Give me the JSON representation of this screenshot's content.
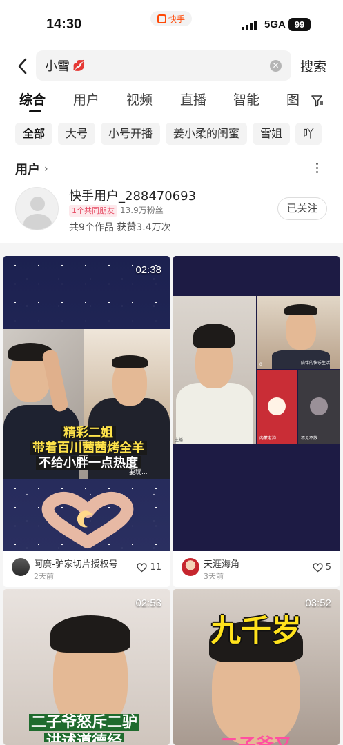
{
  "status": {
    "time": "14:30",
    "app_name": "快手",
    "network": "5GA",
    "battery": "99"
  },
  "search": {
    "query": "小雪",
    "emoji": "💋",
    "button": "搜索"
  },
  "tabs": [
    "综合",
    "用户",
    "视频",
    "直播",
    "智能",
    "图"
  ],
  "chips": [
    "全部",
    "大号",
    "小号开播",
    "姜小柔的闺蜜",
    "雪姐",
    "吖"
  ],
  "user_section": {
    "title": "用户",
    "user": {
      "name": "快手用户_288470693",
      "mutual": "1个共同朋友",
      "fans": "13.9万粉丝",
      "stats": "共9个作品 获赞3.4万次",
      "follow_label": "已关注"
    }
  },
  "videos": [
    {
      "duration": "02:38",
      "author": "阿廣-驴家切片授权号",
      "time": "2天前",
      "likes": "11",
      "caption": [
        "精彩二姐",
        "带着百川茜茜烤全羊",
        "不给小胖一点热度"
      ],
      "overlay_tag": "要玩..."
    },
    {
      "duration": "",
      "author": "天涯海角",
      "time": "3天前",
      "likes": "5",
      "live_tag": "陪伴的快乐生活",
      "tiles": [
        "主播",
        "0",
        "内蒙老狗...",
        "0",
        "不见不散..."
      ]
    },
    {
      "duration": "02:53",
      "caption": [
        "二子爷怒斥二驴",
        "讲述道德经"
      ]
    },
    {
      "duration": "03:52",
      "caption": [
        "九千岁",
        "二子爷又"
      ]
    }
  ],
  "colors": {
    "accent": "#ff4906",
    "badge_bg": "#fde9ec",
    "badge_text": "#e64b63"
  }
}
